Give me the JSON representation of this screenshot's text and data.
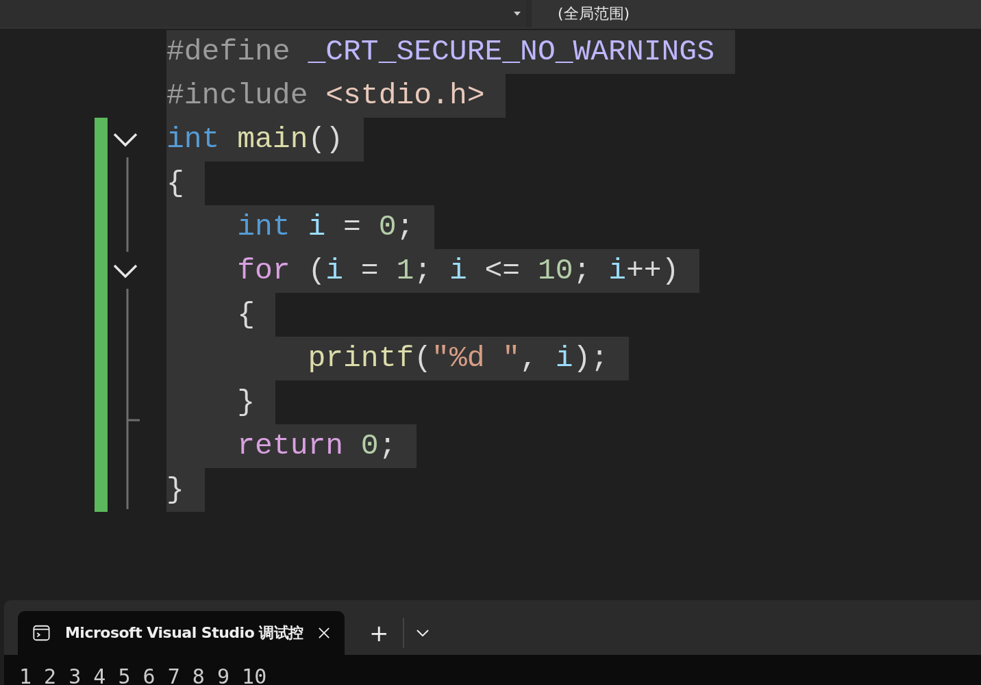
{
  "scope_bar": {
    "scope": "(全局范围)"
  },
  "code": [
    {
      "changed": false,
      "tokens": [
        {
          "kind": "pre",
          "text": "#define "
        },
        {
          "kind": "macro",
          "text": "_CRT_SECURE_NO_WARNINGS"
        }
      ]
    },
    {
      "changed": false,
      "tokens": [
        {
          "kind": "pre",
          "text": "#include "
        },
        {
          "kind": "path",
          "text": "<stdio.h>"
        }
      ]
    },
    {
      "changed": true,
      "fold": {
        "expanded": true
      },
      "tokens": [
        {
          "kind": "keyword",
          "text": "int"
        },
        {
          "kind": "function",
          "text": " main"
        },
        {
          "kind": "plain",
          "text": "()"
        }
      ]
    },
    {
      "changed": true,
      "tokens": [
        {
          "kind": "plain",
          "text": "{"
        }
      ]
    },
    {
      "changed": true,
      "tokens": [
        {
          "kind": "keyword",
          "text": "    int"
        },
        {
          "kind": "var",
          "text": " i"
        },
        {
          "kind": "plain",
          "text": " = "
        },
        {
          "kind": "number",
          "text": "0"
        },
        {
          "kind": "plain",
          "text": ";"
        }
      ]
    },
    {
      "changed": true,
      "fold": {
        "expanded": true
      },
      "tokens": [
        {
          "kind": "control",
          "text": "    for"
        },
        {
          "kind": "plain",
          "text": " ("
        },
        {
          "kind": "var",
          "text": "i"
        },
        {
          "kind": "plain",
          "text": " = "
        },
        {
          "kind": "number",
          "text": "1"
        },
        {
          "kind": "plain",
          "text": "; "
        },
        {
          "kind": "var",
          "text": "i"
        },
        {
          "kind": "plain",
          "text": " <= "
        },
        {
          "kind": "number",
          "text": "10"
        },
        {
          "kind": "plain",
          "text": "; "
        },
        {
          "kind": "var",
          "text": "i"
        },
        {
          "kind": "plain",
          "text": "++)"
        }
      ]
    },
    {
      "changed": true,
      "tokens": [
        {
          "kind": "plain",
          "text": "    {"
        }
      ]
    },
    {
      "changed": true,
      "tokens": [
        {
          "kind": "function",
          "text": "        printf"
        },
        {
          "kind": "plain",
          "text": "("
        },
        {
          "kind": "string",
          "text": "\"%d \""
        },
        {
          "kind": "plain",
          "text": ", "
        },
        {
          "kind": "var",
          "text": "i"
        },
        {
          "kind": "plain",
          "text": ");"
        }
      ]
    },
    {
      "changed": true,
      "tokens": [
        {
          "kind": "plain",
          "text": "    }"
        }
      ]
    },
    {
      "changed": true,
      "tokens": [
        {
          "kind": "control",
          "text": "    return"
        },
        {
          "kind": "number",
          "text": " 0"
        },
        {
          "kind": "plain",
          "text": ";"
        }
      ]
    },
    {
      "changed": true,
      "tokens": [
        {
          "kind": "plain",
          "text": "}"
        }
      ]
    }
  ],
  "terminal": {
    "tabs": [
      {
        "title": "Microsoft Visual Studio 调试控",
        "selected": true
      }
    ],
    "new_tab": "+",
    "output": "1 2 3 4 5 6 7 8 9 10"
  }
}
